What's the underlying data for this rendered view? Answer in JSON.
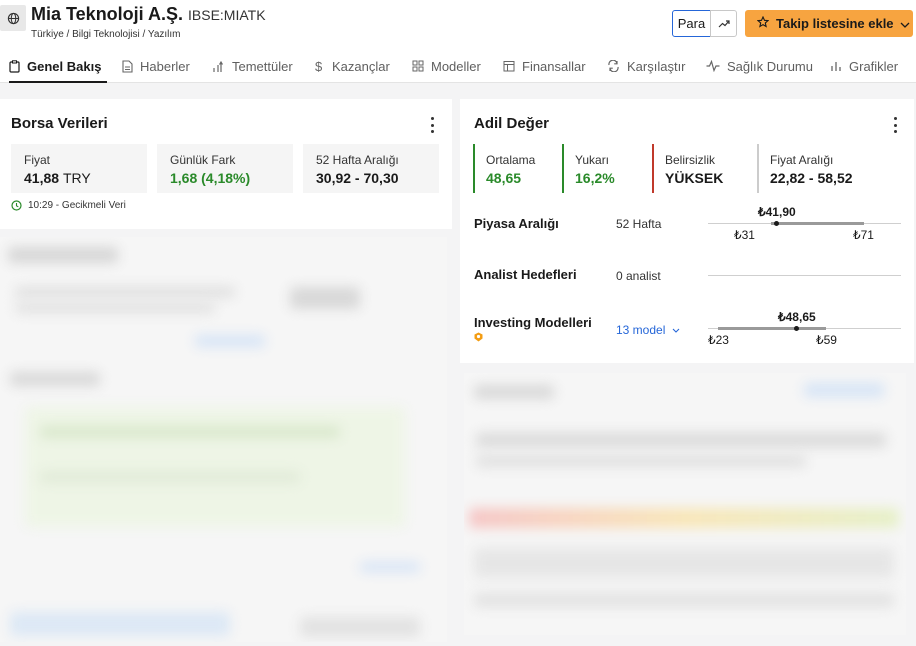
{
  "header": {
    "company_name": "Mia Teknoloji A.Ş.",
    "ticker": "IBSE:MIATK",
    "breadcrumb": "Türkiye / Bilgi Teknolojisi / Yazılım",
    "currency_button": "Para",
    "watchlist_button": "Takip listesine ekle"
  },
  "tabs": [
    {
      "label": "Genel Bakış",
      "icon": "clipboard-icon"
    },
    {
      "label": "Haberler",
      "icon": "document-icon"
    },
    {
      "label": "Temettüler",
      "icon": "dividend-icon"
    },
    {
      "label": "Kazançlar",
      "icon": "dollar-icon"
    },
    {
      "label": "Modeller",
      "icon": "grid-icon"
    },
    {
      "label": "Finansallar",
      "icon": "calendar-icon"
    },
    {
      "label": "Karşılaştır",
      "icon": "compare-icon"
    },
    {
      "label": "Sağlık Durumu",
      "icon": "pulse-icon"
    },
    {
      "label": "Grafikler",
      "icon": "bar-chart-icon"
    }
  ],
  "market_data": {
    "title": "Borsa Verileri",
    "price_label": "Fiyat",
    "price_value": "41,88",
    "price_unit": "TRY",
    "change_label": "Günlük Fark",
    "change_value": "1,68 (4,18%)",
    "range_label": "52 Hafta Aralığı",
    "range_value": "30,92 - 70,30",
    "delay_text": "10:29 - Gecikmeli Veri"
  },
  "fair_value": {
    "title": "Adil Değer",
    "stats": [
      {
        "label": "Ortalama",
        "value": "48,65",
        "accent": "#2a8a2a"
      },
      {
        "label": "Yukarı",
        "value": "16,2%",
        "accent": "#2a8a2a"
      },
      {
        "label": "Belirsizlik",
        "value": "YÜKSEK",
        "accent": "#c0392b"
      },
      {
        "label": "Fiyat Aralığı",
        "value": "22,82 - 58,52",
        "accent": "#cccccc"
      }
    ],
    "rows": {
      "market_range": {
        "label": "Piyasa Aralığı",
        "sub": "52 Hafta",
        "current": "₺41,90",
        "low": "₺31",
        "high": "₺71"
      },
      "analyst": {
        "label": "Analist Hedefleri",
        "sub": "0 analist"
      },
      "models": {
        "label": "Investing Modelleri",
        "link": "13 model",
        "current": "₺48,65",
        "low": "₺23",
        "high": "₺59"
      }
    }
  },
  "colors": {
    "accent_orange": "#f7a440",
    "link_blue": "#2566d8",
    "positive_green": "#2a8a2a",
    "warning_red": "#c0392b"
  }
}
